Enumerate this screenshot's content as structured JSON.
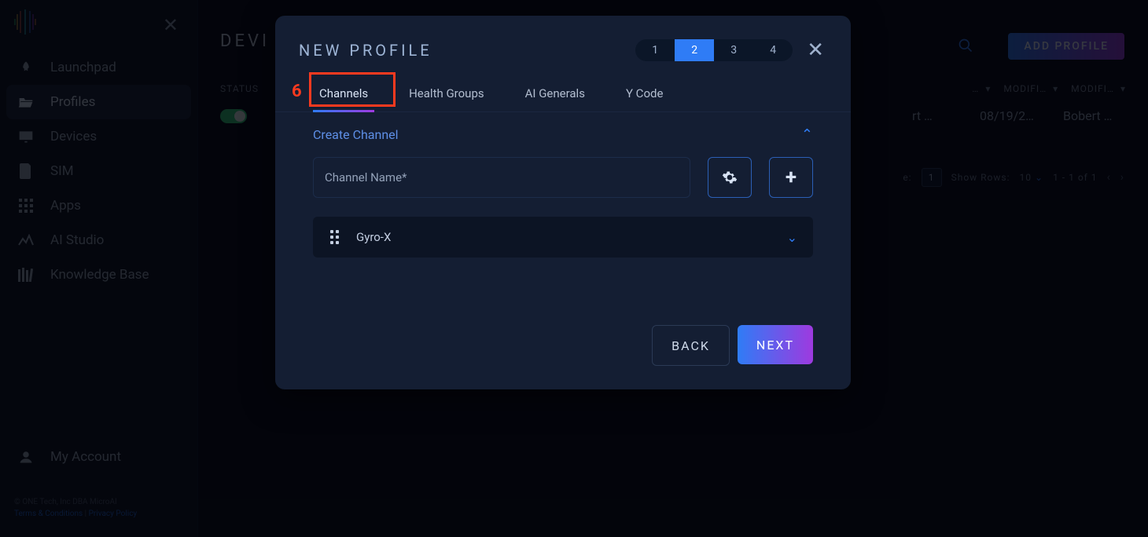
{
  "sidebar": {
    "items": [
      {
        "label": "Launchpad"
      },
      {
        "label": "Profiles"
      },
      {
        "label": "Devices"
      },
      {
        "label": "SIM"
      },
      {
        "label": "Apps"
      },
      {
        "label": "AI Studio"
      },
      {
        "label": "Knowledge Base"
      }
    ],
    "account_label": "My Account",
    "legal_copyright": "© ONE Tech, Inc DBA MicroAI",
    "legal_terms": "Terms & Conditions",
    "legal_sep": " | ",
    "legal_privacy": "Privacy Policy"
  },
  "page": {
    "title_fragment": "DEVI",
    "add_button": "ADD PROFILE"
  },
  "table": {
    "status_header": "STATUS",
    "col_truncated_a": "…",
    "col_modified_a": "MODIFI…",
    "col_modified_b": "MODIFI…",
    "row_user_a": "rt …",
    "row_date": "08/19/2…",
    "row_user_b": "Bobert …"
  },
  "pager": {
    "go_label": "e:",
    "go_value": "1",
    "show_label": "Show Rows:",
    "show_value": "10",
    "range": "1 - 1 of 1"
  },
  "modal": {
    "title": "NEW PROFILE",
    "steps": [
      "1",
      "2",
      "3",
      "4"
    ],
    "active_step_index": 1,
    "tabs": [
      "Channels",
      "Health Groups",
      "AI Generals",
      "Y Code"
    ],
    "active_tab_index": 0,
    "annotation_number": "6",
    "section_title": "Create Channel",
    "input_placeholder": "Channel Name*",
    "existing_channel": "Gyro-X",
    "back_label": "BACK",
    "next_label": "NEXT"
  }
}
